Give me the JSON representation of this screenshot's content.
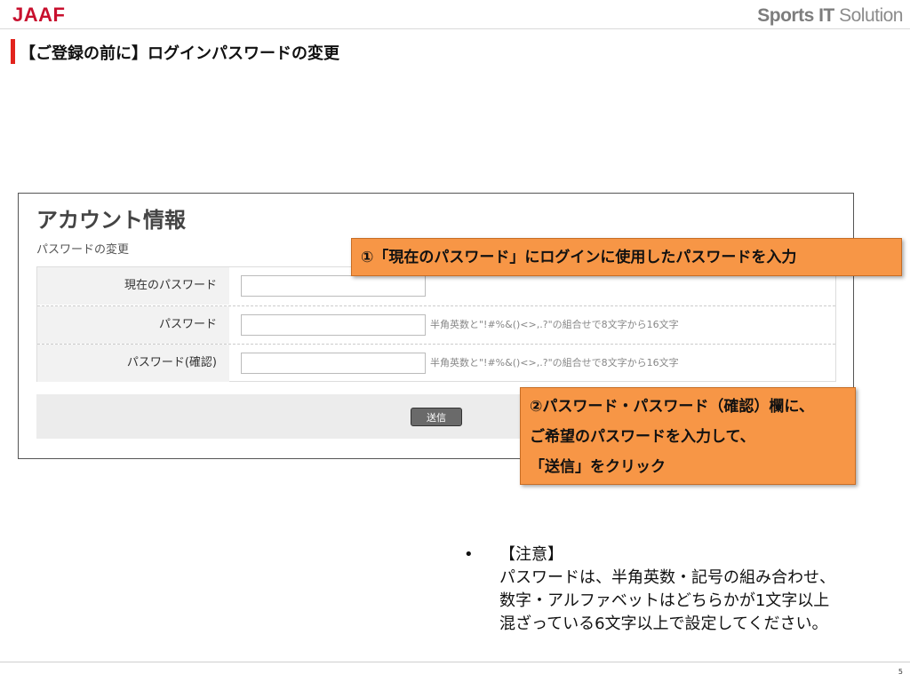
{
  "header": {
    "logo": "JAAF",
    "brand_bold": "Sports IT",
    "brand_rest": " Solution"
  },
  "page_title": "【ご登録の前に】ログインパスワードの変更",
  "panel": {
    "heading": "アカウント情報",
    "subheading": "パスワードの変更",
    "rows": [
      {
        "label": "現在のパスワード",
        "value": "",
        "hint": ""
      },
      {
        "label": "パスワード",
        "value": "",
        "hint": "半角英数と\"!#%&()<>,.?\"の組合せで8文字から16文字"
      },
      {
        "label": "パスワード(確認)",
        "value": "",
        "hint": "半角英数と\"!#%&()<>,.?\"の組合せで8文字から16文字"
      }
    ],
    "submit_label": "送信"
  },
  "callouts": {
    "first": "①「現在のパスワード」にログインに使用したパスワードを入力",
    "second_lines": [
      "②パスワード・パスワード（確認）欄に、",
      "ご希望のパスワードを入力して、",
      "「送信」をクリック"
    ]
  },
  "note": {
    "bullet": "•",
    "lines": [
      "【注意】",
      "パスワードは、半角英数・記号の組み合わせ、",
      "数字・アルファベットはどちらかが1文字以上",
      "混ざっている6文字以上で設定してください。"
    ]
  },
  "page_number": "5",
  "colors": {
    "logo_red": "#c8102e",
    "title_bar_red": "#e2241d",
    "callout_orange": "#f79646",
    "button_gray": "#6a6a6a"
  }
}
